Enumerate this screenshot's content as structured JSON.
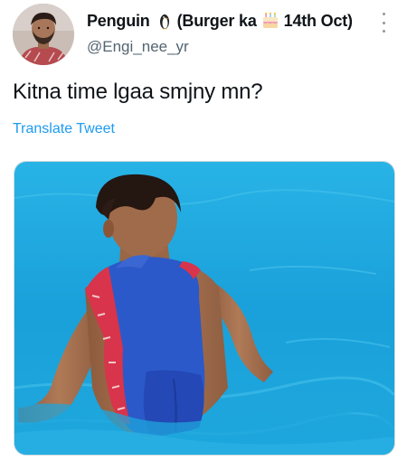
{
  "tweet": {
    "display_name_part1": "Penguin",
    "display_name_part2": "(Burger ka",
    "display_name_part3": "14th Oct)",
    "handle": "@Engi_nee_yr",
    "text": "Kitna time lgaa smjny mn?",
    "translate_label": "Translate Tweet"
  },
  "icons": {
    "penguin": "penguin-emoji",
    "cake": "birthday-cake-emoji",
    "more": "more-options-icon"
  },
  "colors": {
    "text": "#0f1419",
    "secondary": "#536471",
    "link": "#1d9bf0",
    "pool": "#1ca3dd"
  }
}
